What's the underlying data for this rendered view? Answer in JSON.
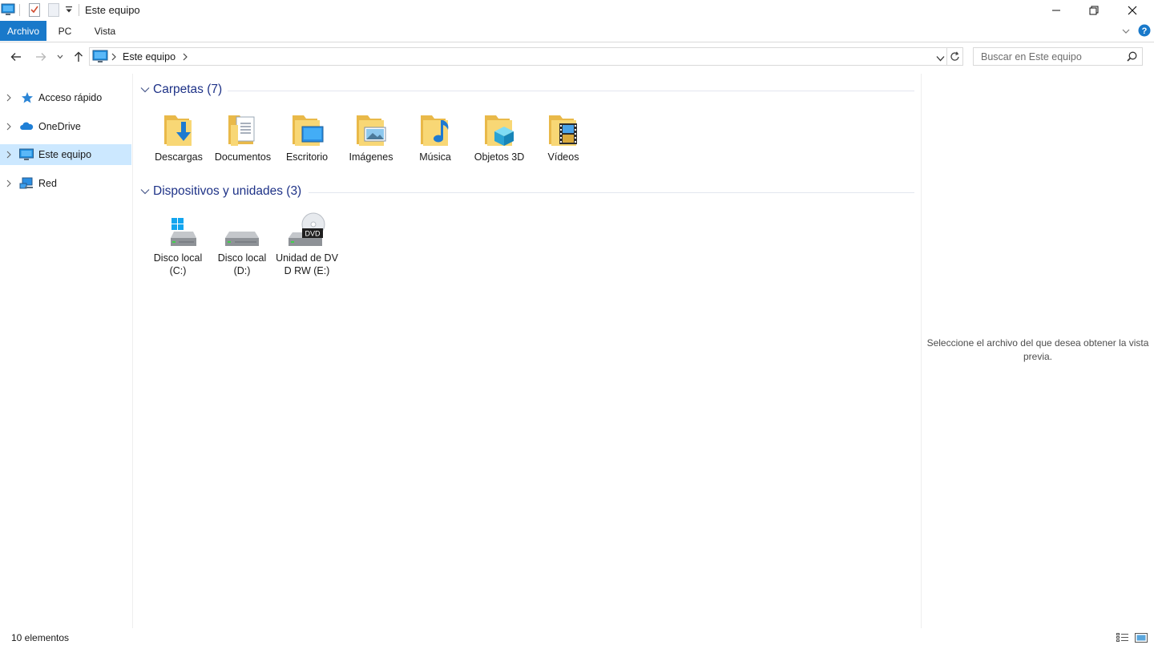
{
  "window": {
    "title": "Este equipo"
  },
  "ribbon": {
    "tabs": [
      {
        "label": "Archivo",
        "active": true
      },
      {
        "label": "PC",
        "active": false
      },
      {
        "label": "Vista",
        "active": false
      }
    ]
  },
  "address": {
    "path": "Este equipo"
  },
  "search": {
    "placeholder": "Buscar en Este equipo"
  },
  "sidebar": {
    "items": [
      {
        "label": "Acceso rápido",
        "icon": "star-icon"
      },
      {
        "label": "OneDrive",
        "icon": "cloud-icon"
      },
      {
        "label": "Este equipo",
        "icon": "computer-icon",
        "selected": true
      },
      {
        "label": "Red",
        "icon": "network-icon"
      }
    ]
  },
  "groups": {
    "folders": {
      "title": "Carpetas (7)",
      "items": [
        {
          "label": "Descargas",
          "icon": "downloads-folder-icon"
        },
        {
          "label": "Documentos",
          "icon": "documents-folder-icon"
        },
        {
          "label": "Escritorio",
          "icon": "desktop-folder-icon"
        },
        {
          "label": "Imágenes",
          "icon": "pictures-folder-icon"
        },
        {
          "label": "Música",
          "icon": "music-folder-icon"
        },
        {
          "label": "Objetos 3D",
          "icon": "3d-objects-folder-icon"
        },
        {
          "label": "Vídeos",
          "icon": "videos-folder-icon"
        }
      ]
    },
    "devices": {
      "title": "Dispositivos y unidades (3)",
      "items": [
        {
          "label": "Disco local (C:)",
          "icon": "system-drive-icon"
        },
        {
          "label": "Disco local (D:)",
          "icon": "hard-drive-icon"
        },
        {
          "label": "Unidad de DVD RW (E:)",
          "icon": "dvd-drive-icon",
          "badge": "DVD"
        }
      ]
    }
  },
  "preview": {
    "message": "Seleccione el archivo del que desea obtener la vista previa."
  },
  "status": {
    "count": "10 elementos"
  },
  "colors": {
    "accent": "#1979ca",
    "selection": "#cce8ff",
    "group_title": "#1e3287",
    "folder": "#f8d775"
  }
}
